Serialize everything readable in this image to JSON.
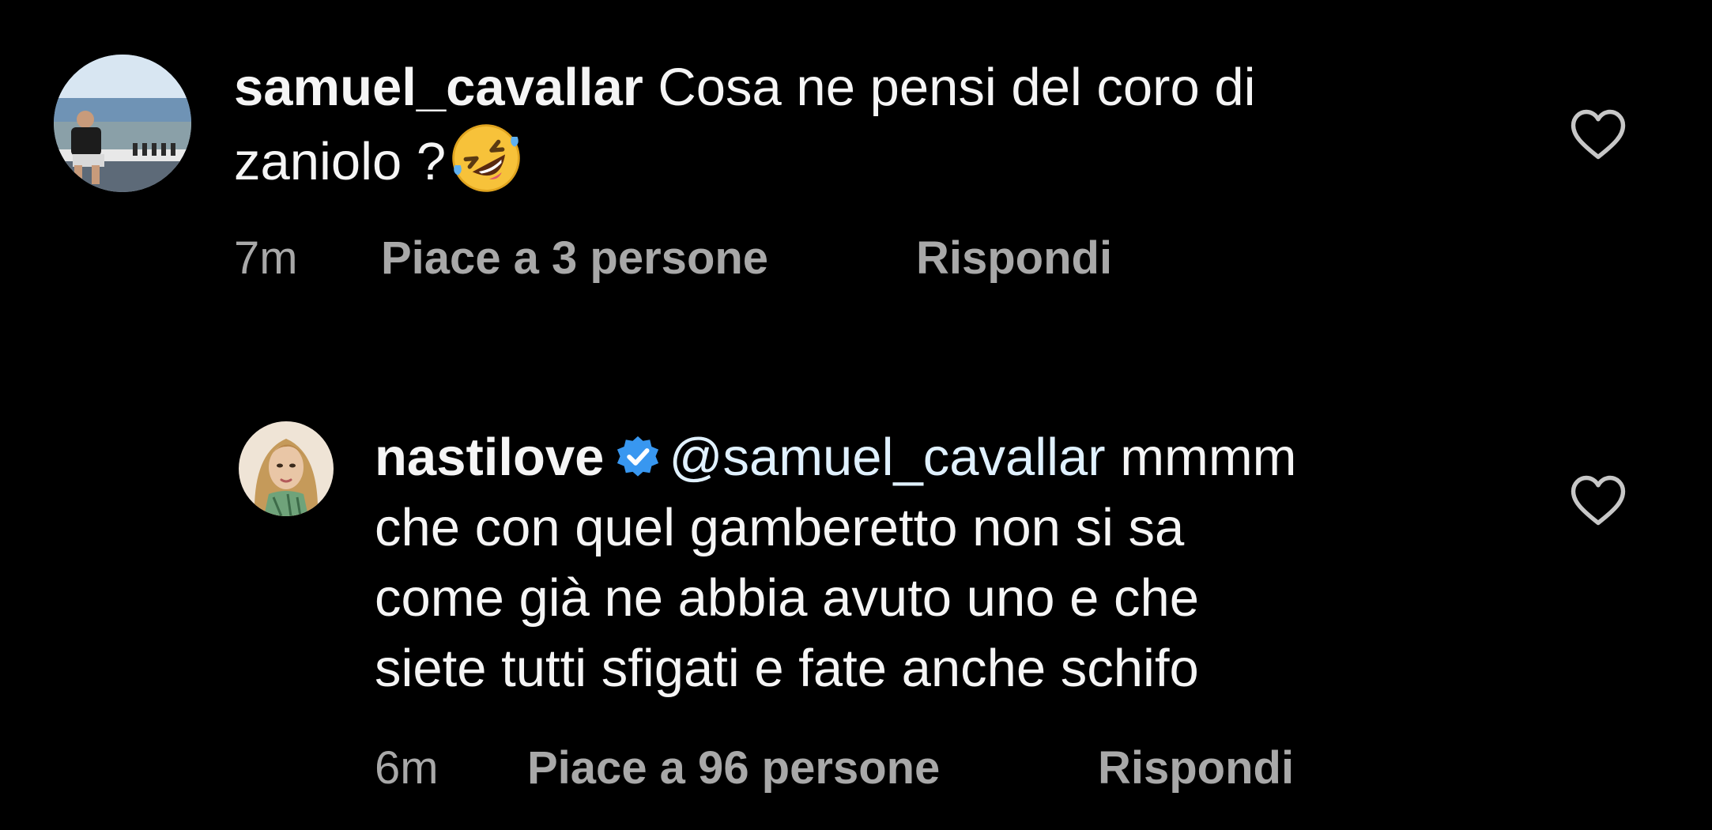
{
  "comments": [
    {
      "username": "samuel_cavallar",
      "text_line1": "Cosa ne pensi del coro di",
      "text_line2": "zaniolo ?",
      "emoji": "rolling-on-the-floor-laughing",
      "time": "7m",
      "likes": "Piace a 3 persone",
      "reply": "Rispondi",
      "verified": false
    },
    {
      "username": "nastilove",
      "mention": "@samuel_cavallar",
      "text_line1_rest": "mmmm",
      "text_lines": [
        "che con quel gamberetto non si sa",
        "come già ne abbia avuto uno e che",
        "siete tutti sfigati e fate anche schifo"
      ],
      "time": "6m",
      "likes": "Piace a 96 persone",
      "reply": "Rispondi",
      "verified": true
    }
  ],
  "colors": {
    "background": "#000000",
    "text": "#f5f5f5",
    "meta": "#a8a8a8",
    "verified": "#3897f0",
    "mention": "#e0f1ff"
  },
  "icons": {
    "like": "heart-outline-icon",
    "verified": "verified-badge-icon"
  }
}
